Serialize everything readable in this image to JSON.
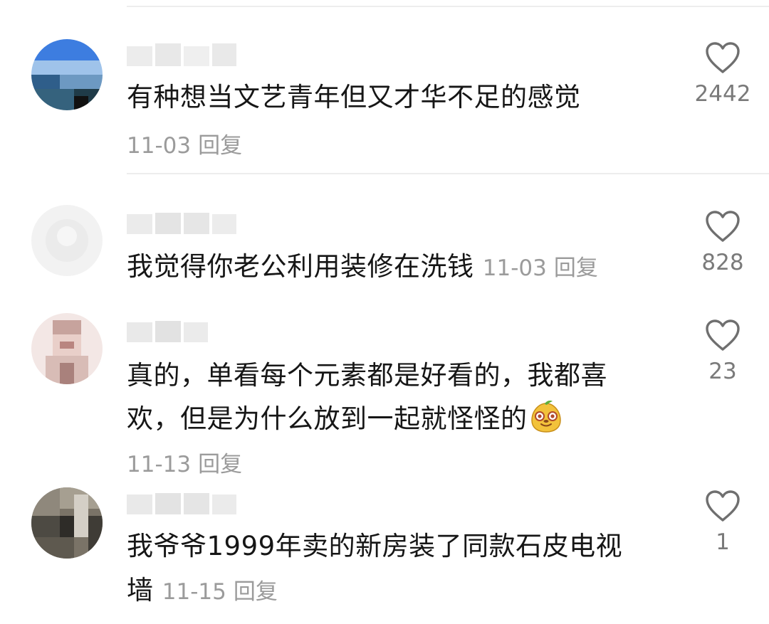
{
  "comments": [
    {
      "text_lines": [
        "有种想当文艺青年但又才华不足的感觉"
      ],
      "date": "11-03",
      "reply_label": "回复",
      "likes": "2442",
      "avatar_colors": [
        "#2f6fd0",
        "#4d8ae6",
        "#8fb8e8",
        "#3b5566",
        "#1f3d4f",
        "#6a8fa5"
      ]
    },
    {
      "text_lines": [
        "我觉得你老公利用装修在洗钱"
      ],
      "date": "11-03",
      "reply_label": "回复",
      "likes": "828",
      "avatar_colors": [
        "#eeeeee",
        "#f3f3f3",
        "#e6e6e6",
        "#f7f7f7"
      ]
    },
    {
      "text_lines": [
        "真的，单看每个元素都是好看的，我都喜",
        "欢，但是为什么放到一起就怪怪的"
      ],
      "date": "11-13",
      "reply_label": "回复",
      "likes": "23",
      "avatar_colors": [
        "#f1e4e2",
        "#d9b8b2",
        "#c99a93",
        "#efd9d4",
        "#b78a86",
        "#f7ecea"
      ]
    },
    {
      "text_lines": [
        "我爷爷1999年卖的新房装了同款石皮电视",
        "墙"
      ],
      "date": "11-15",
      "reply_label": "回复",
      "likes": "1",
      "avatar_colors": [
        "#6b6457",
        "#8c857a",
        "#4a4a44",
        "#a49c8e",
        "#3e3b35",
        "#7d7466"
      ]
    }
  ],
  "icons": {
    "like": "heart-outline-icon",
    "emoji": "smiling-fruit-emoji"
  },
  "colors": {
    "text": "#161616",
    "meta": "#9b9b9b",
    "like_count": "#7a7a7a",
    "divider": "#ededed",
    "heart_stroke": "#6f6f6f"
  }
}
